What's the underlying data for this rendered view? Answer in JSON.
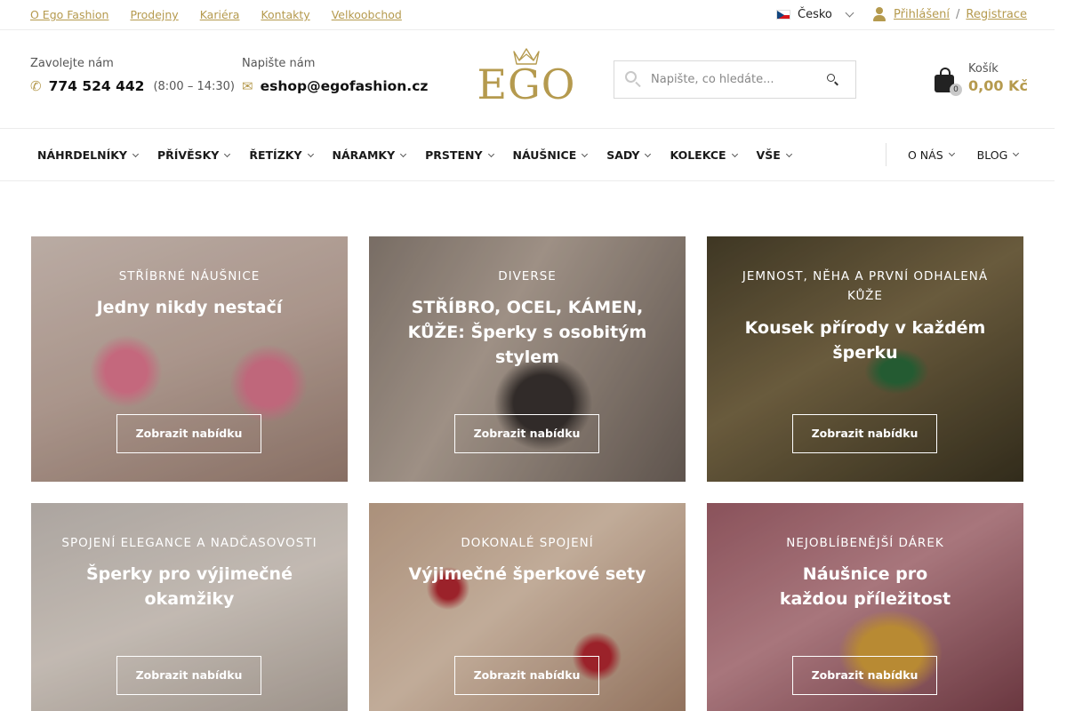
{
  "topbar": {
    "links": [
      "O Ego Fashion",
      "Prodejny",
      "Kariéra",
      "Kontakty",
      "Velkoobchod"
    ],
    "language": "Česko",
    "login": "Přihlášení",
    "separator": "/",
    "register": "Registrace"
  },
  "header": {
    "phone": {
      "label": "Zavolejte nám",
      "number": "774 524 442",
      "hours": "(8:00 – 14:30)"
    },
    "email": {
      "label": "Napište nám",
      "address": "eshop@egofashion.cz"
    },
    "logo": "EGO",
    "search": {
      "placeholder": "Napište, co hledáte..."
    },
    "cart": {
      "label": "Košík",
      "count": "0",
      "amount": "0,00 Kč"
    }
  },
  "nav": {
    "items": [
      "NÁHRDELNÍKY",
      "PŘÍVĚSKY",
      "ŘETÍZKY",
      "NÁRAMKY",
      "PRSTENY",
      "NÁUŠNICE",
      "SADY",
      "KOLEKCE",
      "VŠE"
    ],
    "right": [
      "O NÁS",
      "BLOG"
    ]
  },
  "tiles": [
    {
      "kicker": "STŘÍBRNÉ NÁUŠNICE",
      "title": "Jedny nikdy nestačí",
      "button": "Zobrazit nabídku"
    },
    {
      "kicker": "DIVERSE",
      "title": "STŘÍBRO, OCEL, KÁMEN, KŮŽE: Šperky s osobitým stylem",
      "button": "Zobrazit nabídku"
    },
    {
      "kicker": "JEMNOST, NĚHA A PRVNÍ ODHALENÁ KŮŽE",
      "title": "Kousek přírody v každém šperku",
      "button": "Zobrazit nabídku"
    },
    {
      "kicker": "SPOJENÍ ELEGANCE A NADČASOVOSTI",
      "title": "Šperky pro výjimečné okamžiky",
      "button": "Zobrazit nabídku"
    },
    {
      "kicker": "DOKONALÉ SPOJENÍ",
      "title": "Výjimečné šperkové sety",
      "button": "Zobrazit nabídku"
    },
    {
      "kicker": "NEJOBLÍBENĚJŠÍ DÁREK",
      "title": "Náušnice pro každou příležitost",
      "button": "Zobrazit nabídku"
    }
  ],
  "colors": {
    "accent": "#b59a4e",
    "text": "#1a1a1a"
  },
  "icons": {
    "phone": "phone-icon",
    "email": "envelope-icon",
    "user": "user-icon",
    "cart": "shopping-bag-icon",
    "search": "search-icon"
  }
}
